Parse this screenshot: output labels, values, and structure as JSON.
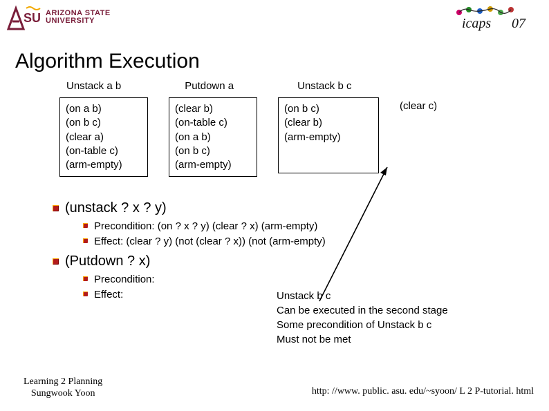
{
  "header": {
    "asu_line1": "ARIZONA STATE",
    "asu_line2": "UNIVERSITY",
    "icaps_label": "icaps07"
  },
  "title": "Algorithm Execution",
  "actions": {
    "a1": "Unstack a b",
    "a2": "Putdown a",
    "a3": "Unstack b c"
  },
  "boxes": {
    "b1": "(on a b)\n(on b c)\n(clear a)\n(on-table c)\n(arm-empty)",
    "b2": "(clear b)\n(on-table c)\n(on a b)\n(on b c)\n(arm-empty)",
    "b3": "(on b c)\n(clear b)\n(arm-empty)",
    "final": "(clear c)"
  },
  "bullets": {
    "item1": "(unstack ? x ? y)",
    "item1_sub1": "Precondition: (on ? x ? y) (clear ? x)  (arm-empty)",
    "item1_sub2": "Effect: (clear ? y) (not (clear ? x)) (not (arm-empty)",
    "item2": "(Putdown ? x)",
    "item2_sub1": "Precondition:",
    "item2_sub2": "Effect:"
  },
  "side_note": "Unstack b c\nCan be executed in the second stage\nSome precondition of Unstack b c\nMust not be met",
  "footer": {
    "left_line1": "Learning 2 Planning",
    "left_line2": "Sungwook Yoon",
    "right": "http: //www. public. asu. edu/~syoon/ L 2 P-tutorial. html"
  }
}
